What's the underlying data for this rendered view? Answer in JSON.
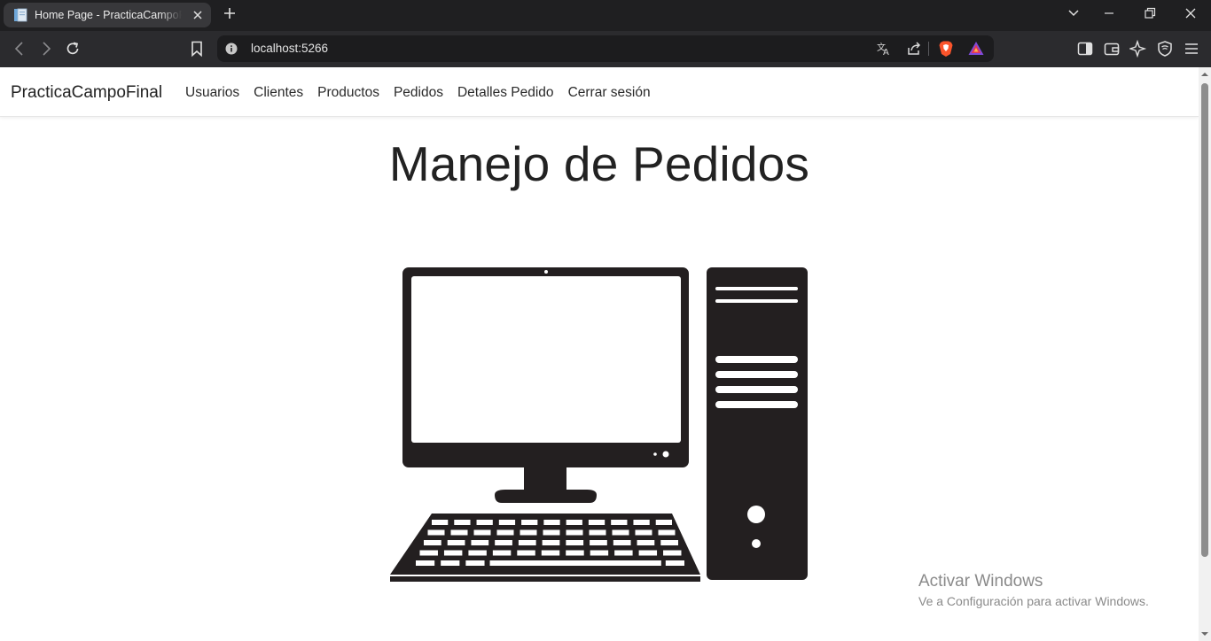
{
  "browser": {
    "tab_title": "Home Page - PracticaCampoFinal",
    "url": "localhost:5266"
  },
  "navbar": {
    "brand": "PracticaCampoFinal",
    "links": [
      "Usuarios",
      "Clientes",
      "Productos",
      "Pedidos",
      "Detalles Pedido",
      "Cerrar sesión"
    ]
  },
  "main": {
    "heading": "Manejo de Pedidos",
    "image_icon": "desktop-computer-icon"
  },
  "watermark": {
    "title": "Activar Windows",
    "subtitle": "Ve a Configuración para activar Windows."
  },
  "colors": {
    "tabbar_bg": "#1f1f21",
    "toolbar_bg": "#2b2b2e",
    "illustration": "#231f20",
    "brave_orange": "#fb542b"
  }
}
